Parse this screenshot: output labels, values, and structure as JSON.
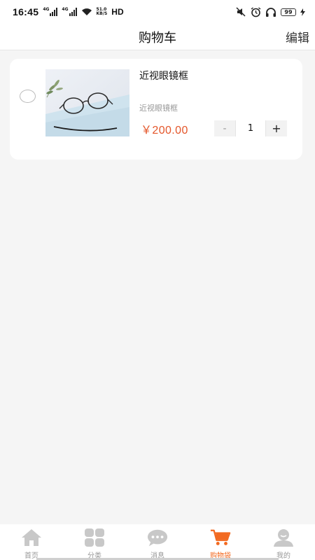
{
  "status_bar": {
    "time": "16:45",
    "signal_tag_1": "4G",
    "signal_tag_2": "4G",
    "speed_value": "51.0",
    "speed_unit": "KB/S",
    "hd_label": "HD",
    "battery": "99"
  },
  "header": {
    "title": "购物车",
    "edit_label": "编辑"
  },
  "cart": {
    "items": [
      {
        "name": "近视眼镜框",
        "spec": "近视眼镜框",
        "price": "￥200.00",
        "quantity": "1",
        "minus_label": "-",
        "plus_label": "+",
        "selected": false
      }
    ]
  },
  "tab_bar": {
    "tabs": [
      {
        "label": "首页",
        "icon": "home-icon",
        "active": false
      },
      {
        "label": "分类",
        "icon": "category-icon",
        "active": false
      },
      {
        "label": "消息",
        "icon": "message-icon",
        "active": false
      },
      {
        "label": "购物袋",
        "icon": "cart-icon",
        "active": true
      },
      {
        "label": "我的",
        "icon": "profile-icon",
        "active": false
      }
    ]
  },
  "colors": {
    "accent": "#f26a21",
    "price": "#e4562a",
    "inactive_icon": "#c8c8c8"
  }
}
